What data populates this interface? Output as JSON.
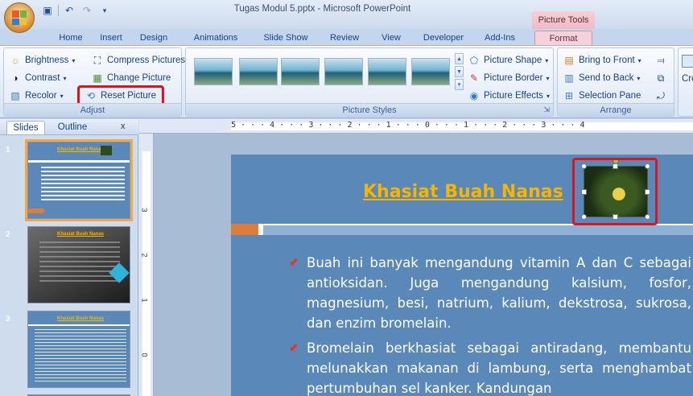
{
  "window": {
    "title": "Tugas Modul 5.pptx - Microsoft PowerPoint",
    "context_tab_title": "Picture Tools"
  },
  "tabs": [
    "Home",
    "Insert",
    "Design",
    "Animations",
    "Slide Show",
    "Review",
    "View",
    "Developer",
    "Add-Ins",
    "Format"
  ],
  "active_tab": "Format",
  "ribbon": {
    "adjust": {
      "label": "Adjust",
      "brightness": "Brightness",
      "compress": "Compress Pictures",
      "contrast": "Contrast",
      "change": "Change Picture",
      "recolor": "Recolor",
      "reset": "Reset Picture"
    },
    "styles": {
      "label": "Picture Styles",
      "shape": "Picture Shape",
      "border": "Picture Border",
      "effects": "Picture Effects"
    },
    "arrange": {
      "label": "Arrange",
      "front": "Bring to Front",
      "back": "Send to Back",
      "selection": "Selection Pane"
    },
    "size": {
      "crop": "Cro"
    }
  },
  "left_pane": {
    "tabs": [
      "Slides",
      "Outline"
    ],
    "close": "x",
    "slides": [
      {
        "num": "1",
        "title": "Khasiat Buah Nanas"
      },
      {
        "num": "2",
        "title": "Khasiat Buah Nanas"
      },
      {
        "num": "3",
        "title": "Khasiat Buah Nanas"
      }
    ]
  },
  "ruler": {
    "h": "5 · · · 4 · · · 3 · · · 2 · · · 1 · · · 0 · · · 1 · · · 2 · · · 3 · · · 4",
    "v": [
      "3",
      "2",
      "1",
      "0"
    ]
  },
  "slide": {
    "title": "Khasiat Buah Nanas",
    "bullets": [
      "Buah ini banyak mengandung vitamin A dan C sebagai antioksidan. Juga mengandung kalsium, fosfor, magnesium, besi, natrium, kalium, dekstrosa, sukrosa, dan enzim bromelain.",
      "Bromelain berkhasiat sebagai antiradang, membantu melunakkan makanan di lambung, serta menghambat pertumbuhan sel kanker. Kandungan"
    ]
  },
  "colors": {
    "highlight": "#e0121a",
    "title": "#f7b500",
    "slide_bg": "#5a88b8",
    "context_tab": "#f2b9c5"
  }
}
